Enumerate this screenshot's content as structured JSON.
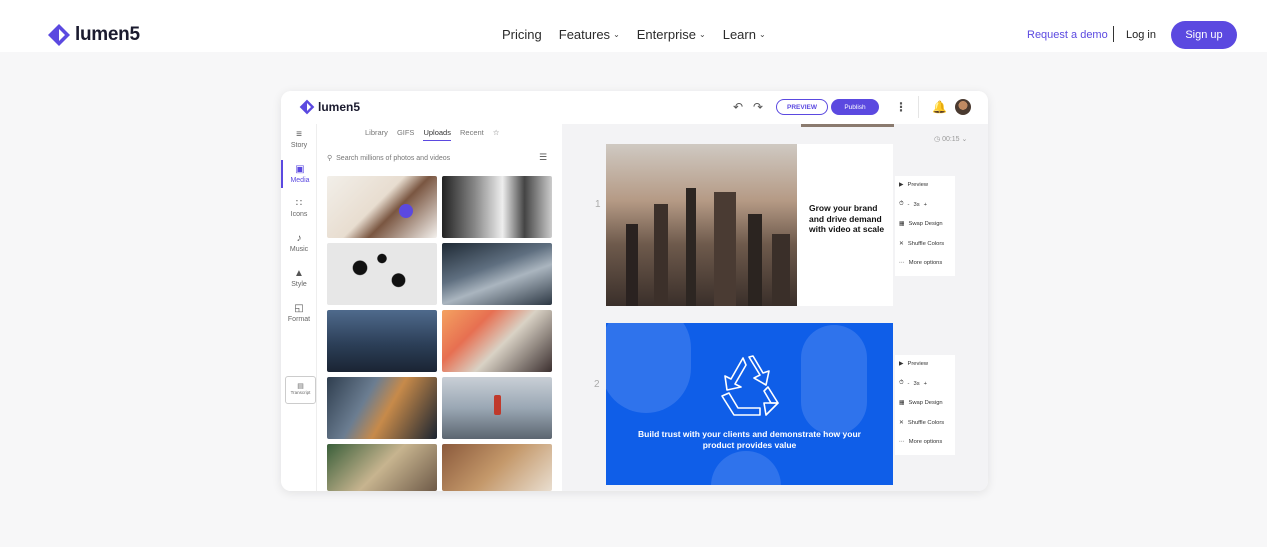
{
  "site": {
    "logo_text": "lumen5",
    "nav": [
      {
        "label": "Pricing",
        "has_dropdown": false
      },
      {
        "label": "Features",
        "has_dropdown": true
      },
      {
        "label": "Enterprise",
        "has_dropdown": true
      },
      {
        "label": "Learn",
        "has_dropdown": true
      }
    ],
    "request_demo": "Request a demo",
    "separator": "|",
    "login": "Log in",
    "signup": "Sign up",
    "brand_color": "#5b49e0"
  },
  "app": {
    "logo_text": "lumen5",
    "preview_label": "PREVIEW",
    "publish_label": "Publish",
    "rail": [
      {
        "label": "Story",
        "icon": "story-icon"
      },
      {
        "label": "Media",
        "icon": "media-icon",
        "active": true
      },
      {
        "label": "Icons",
        "icon": "icons-icon"
      },
      {
        "label": "Music",
        "icon": "music-icon"
      },
      {
        "label": "Style",
        "icon": "style-icon"
      },
      {
        "label": "Format",
        "icon": "format-icon"
      }
    ],
    "transcript_label": "Transcript",
    "media_tabs": [
      "Library",
      "GIFS",
      "Uploads",
      "Recent"
    ],
    "active_tab": "Uploads",
    "search_placeholder": "Search millions of photos and videos",
    "timer": "00:15",
    "slides": [
      {
        "number": "1",
        "text": "Grow your brand and drive demand with video at scale"
      },
      {
        "number": "2",
        "text": "Build trust with your clients and demonstrate how your product provides value"
      }
    ],
    "slide_menu": {
      "preview": "Preview",
      "minus": "-",
      "duration": "3s",
      "plus": "+",
      "swap": "Swap Design",
      "shuffle": "Shuffle Colors",
      "more": "More options"
    }
  }
}
